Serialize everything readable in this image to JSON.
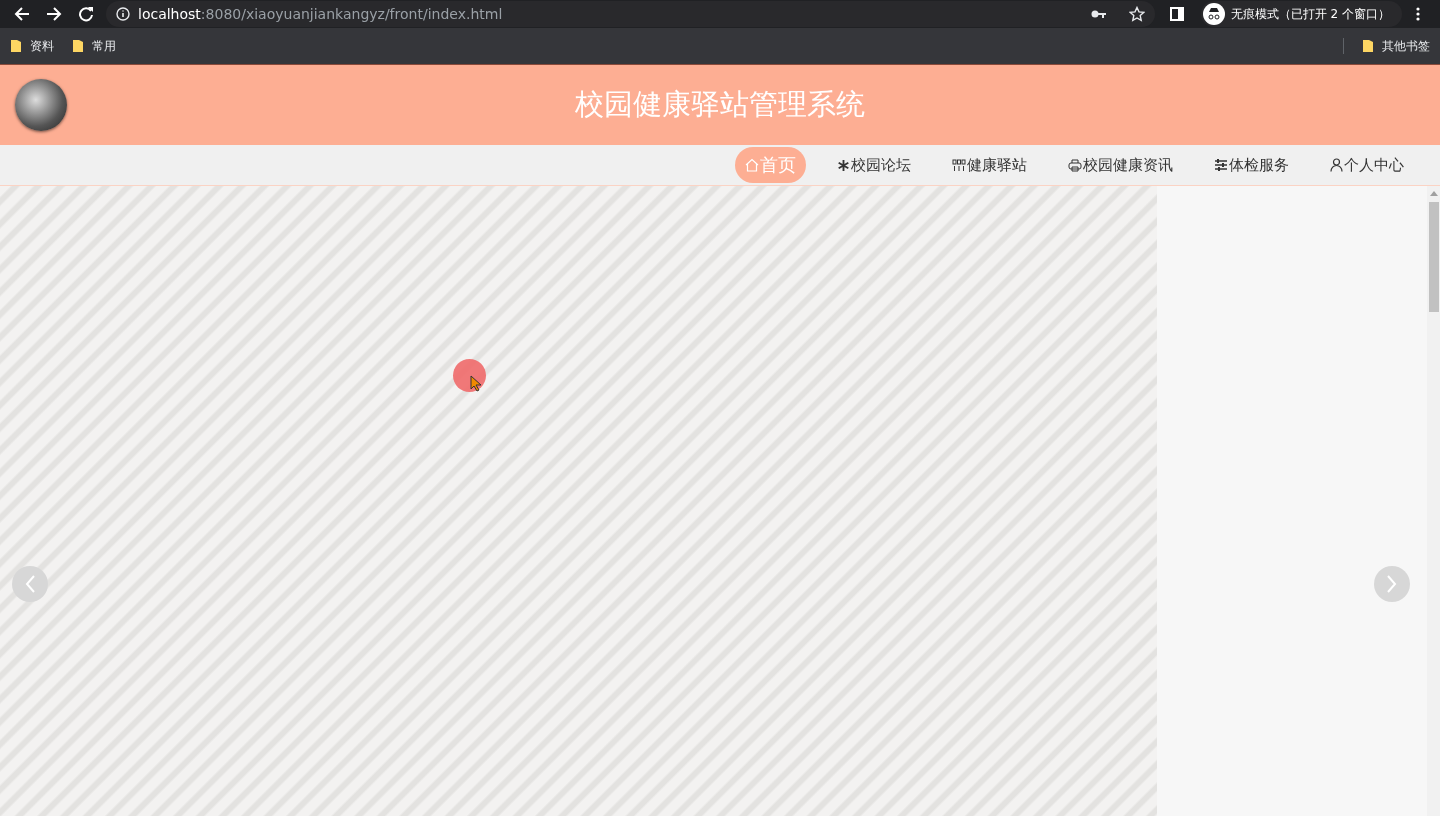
{
  "browser": {
    "address": {
      "host": "localhost",
      "path": ":8080/xiaoyuanjiankangyz/front/index.html"
    },
    "incognito": "无痕模式（已打开 2 个窗口）",
    "bookmarks": [
      "资料",
      "常用"
    ],
    "other_bookmarks": "其他书签"
  },
  "header": {
    "title": "校园健康驿站管理系统"
  },
  "nav": [
    {
      "label": "首页",
      "selected": true
    },
    {
      "label": "校园论坛",
      "selected": false
    },
    {
      "label": "健康驿站",
      "selected": false
    },
    {
      "label": "校园健康资讯",
      "selected": false
    },
    {
      "label": "体检服务",
      "selected": false
    },
    {
      "label": "个人中心",
      "selected": false
    }
  ]
}
